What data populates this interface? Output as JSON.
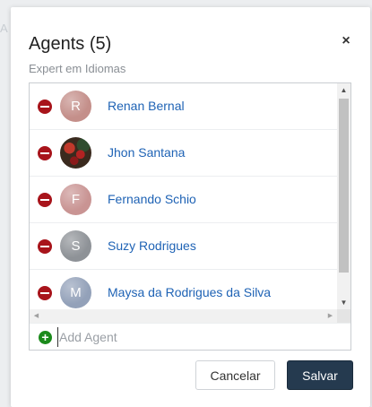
{
  "backdrop": {
    "hint": "A"
  },
  "dialog": {
    "title": "Agents (5)",
    "subtitle": "Expert em Idiomas",
    "close_label": "×"
  },
  "agents": [
    {
      "name": "Renan Bernal",
      "initial": "R",
      "avatar_color": "#c48f8a",
      "avatar_kind": "initial"
    },
    {
      "name": "Jhon Santana",
      "initial": "",
      "avatar_color": "#3a2a1e",
      "avatar_kind": "photo"
    },
    {
      "name": "Fernando Schio",
      "initial": "F",
      "avatar_color": "#c99493",
      "avatar_kind": "initial"
    },
    {
      "name": "Suzy Rodrigues",
      "initial": "S",
      "avatar_color": "#8e9297",
      "avatar_kind": "initial"
    },
    {
      "name": "Maysa da Rodrigues da Silva",
      "initial": "M",
      "avatar_color": "#93a1b9",
      "avatar_kind": "initial"
    }
  ],
  "add_agent": {
    "placeholder": "Add Agent",
    "value": ""
  },
  "footer": {
    "cancel_label": "Cancelar",
    "save_label": "Salvar"
  },
  "colors": {
    "remove": "#a8141b",
    "add": "#1b8a1b",
    "link": "#1f63b5",
    "primary": "#253a4f"
  },
  "icons": {
    "remove": "minus-circle-icon",
    "add": "plus-circle-icon",
    "close": "close-icon"
  }
}
